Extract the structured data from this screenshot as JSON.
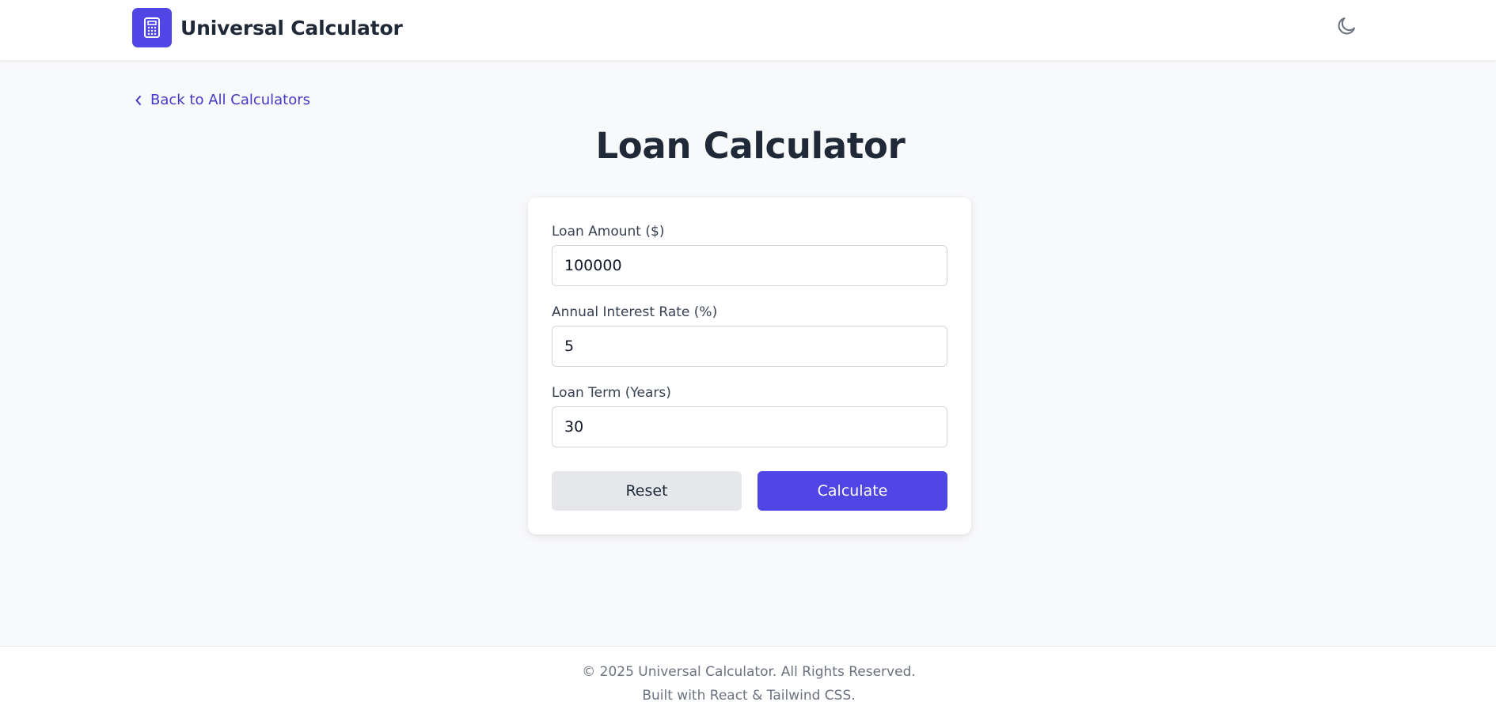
{
  "header": {
    "brand_name": "Universal Calculator",
    "logo_icon": "calculator-icon",
    "theme_icon": "moon-icon"
  },
  "nav": {
    "back_label": "Back to All Calculators",
    "back_icon": "chevron-left-icon"
  },
  "main": {
    "title": "Loan Calculator",
    "form": {
      "loan_amount_label": "Loan Amount ($)",
      "loan_amount_value": "100000",
      "interest_rate_label": "Annual Interest Rate (%)",
      "interest_rate_value": "5",
      "loan_term_label": "Loan Term (Years)",
      "loan_term_value": "30",
      "reset_label": "Reset",
      "calculate_label": "Calculate"
    }
  },
  "footer": {
    "copyright": "© 2025 Universal Calculator. All Rights Reserved.",
    "built_with": "Built with React & Tailwind CSS."
  },
  "colors": {
    "accent": "#4f46e5",
    "link": "#4338ca",
    "background": "#f8f9fb",
    "secondary_button": "#e5e7eb"
  }
}
